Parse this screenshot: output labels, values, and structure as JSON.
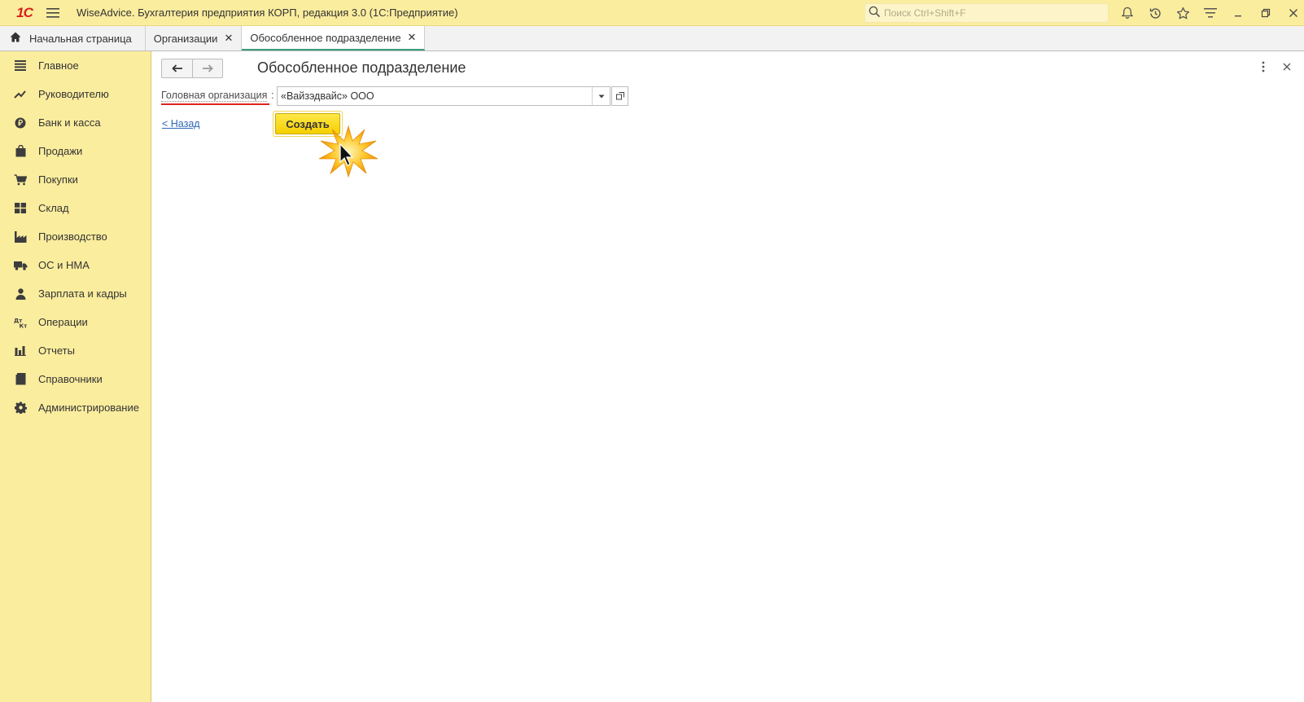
{
  "app": {
    "logo": "1С",
    "title": "WiseAdvice. Бухгалтерия предприятия КОРП, редакция 3.0  (1С:Предприятие)",
    "search_placeholder": "Поиск Ctrl+Shift+F"
  },
  "tabs": [
    {
      "label": "Начальная страница",
      "active": false,
      "closable": false
    },
    {
      "label": "Организации",
      "active": false,
      "closable": true
    },
    {
      "label": "Обособленное подразделение",
      "active": true,
      "closable": true
    }
  ],
  "tab_close_glyph": "✕",
  "sidebar": {
    "items": [
      {
        "label": "Главное",
        "icon": "menu-lines-icon"
      },
      {
        "label": "Руководителю",
        "icon": "trend-up-icon"
      },
      {
        "label": "Банк и касса",
        "icon": "ruble-coin-icon"
      },
      {
        "label": "Продажи",
        "icon": "shopping-bag-icon"
      },
      {
        "label": "Покупки",
        "icon": "cart-icon"
      },
      {
        "label": "Склад",
        "icon": "warehouse-grid-icon"
      },
      {
        "label": "Производство",
        "icon": "factory-icon"
      },
      {
        "label": "ОС и НМА",
        "icon": "truck-icon"
      },
      {
        "label": "Зарплата и кадры",
        "icon": "person-icon"
      },
      {
        "label": "Операции",
        "icon": "debit-credit-icon"
      },
      {
        "label": "Отчеты",
        "icon": "bar-chart-icon"
      },
      {
        "label": "Справочники",
        "icon": "book-icon"
      },
      {
        "label": "Администрирование",
        "icon": "gear-icon"
      }
    ]
  },
  "form": {
    "title": "Обособленное подразделение",
    "head_org_label": "Головная организация",
    "head_org_colon": ":",
    "head_org_value": "«Вайзэдвайс» ООО",
    "back_link": "< Назад",
    "create_button": "Создать"
  },
  "colors": {
    "panel": "#fbed9e",
    "accent_button": "#f5d000",
    "active_tab_underline": "#3a9d7a",
    "required_underline": "#e0231b",
    "link": "#2d67b6"
  }
}
